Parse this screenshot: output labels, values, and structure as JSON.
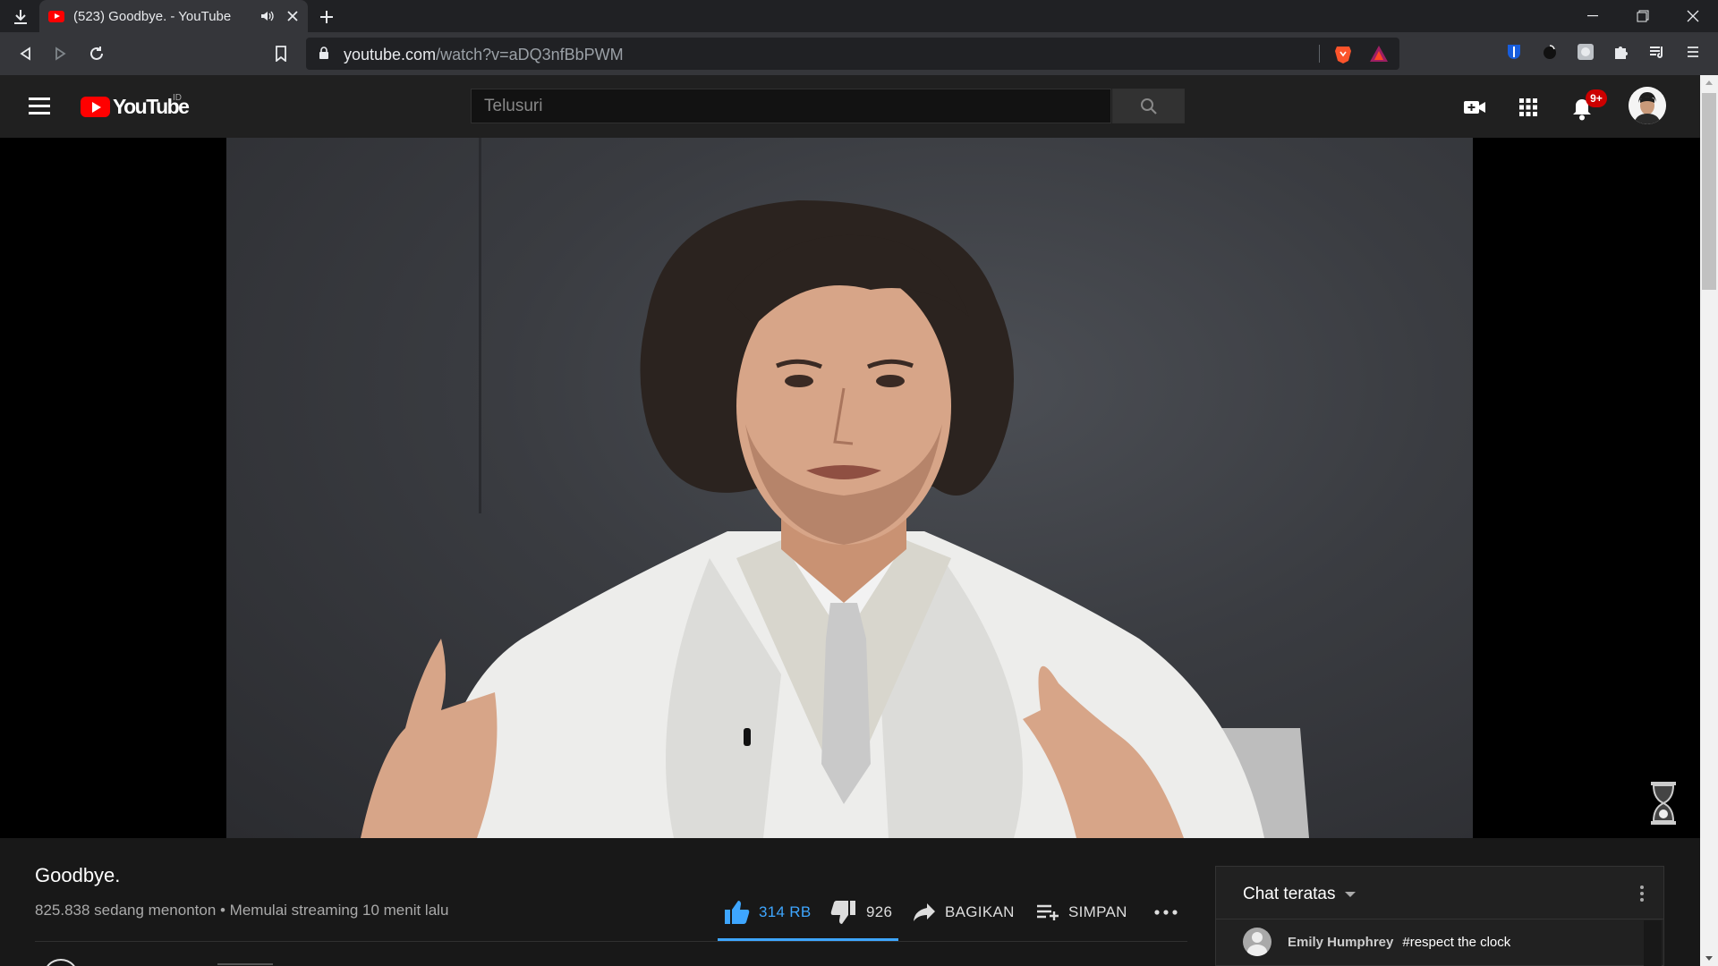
{
  "browser": {
    "tab": {
      "title": "(523) Goodbye. - YouTube",
      "icon": "youtube-favicon"
    },
    "url_host": "youtube.com",
    "url_path": "/watch?v=aDQ3nfBbPWM",
    "icons": [
      "download-icon",
      "speaker-icon",
      "close-tab-icon",
      "new-tab-icon",
      "back-icon",
      "forward-icon",
      "reload-icon",
      "bookmark-icon",
      "lock-icon",
      "brave-shields-icon",
      "brave-rewards-icon",
      "bitwarden-icon",
      "ext-dark-icon",
      "ext-gray-icon",
      "extensions-icon",
      "playlist-icon",
      "menu-icon",
      "minimize-icon",
      "restore-icon",
      "close-window-icon"
    ]
  },
  "youtube": {
    "logo_text": "YouTube",
    "region": "ID",
    "search_placeholder": "Telusuri",
    "notifications_badge": "9+",
    "accent": "#3ea6ff",
    "brand_red": "#ff0000"
  },
  "video": {
    "title": "Goodbye.",
    "view_info": "825.838 sedang menonton • Memulai streaming 10 menit lalu",
    "likes": "314 RB",
    "dislikes": "926",
    "share_label": "BAGIKAN",
    "save_label": "SIMPAN"
  },
  "chat": {
    "mode_label": "Chat teratas",
    "messages": [
      {
        "author": "Emily Humphrey",
        "text": "#respect the clock"
      }
    ]
  }
}
